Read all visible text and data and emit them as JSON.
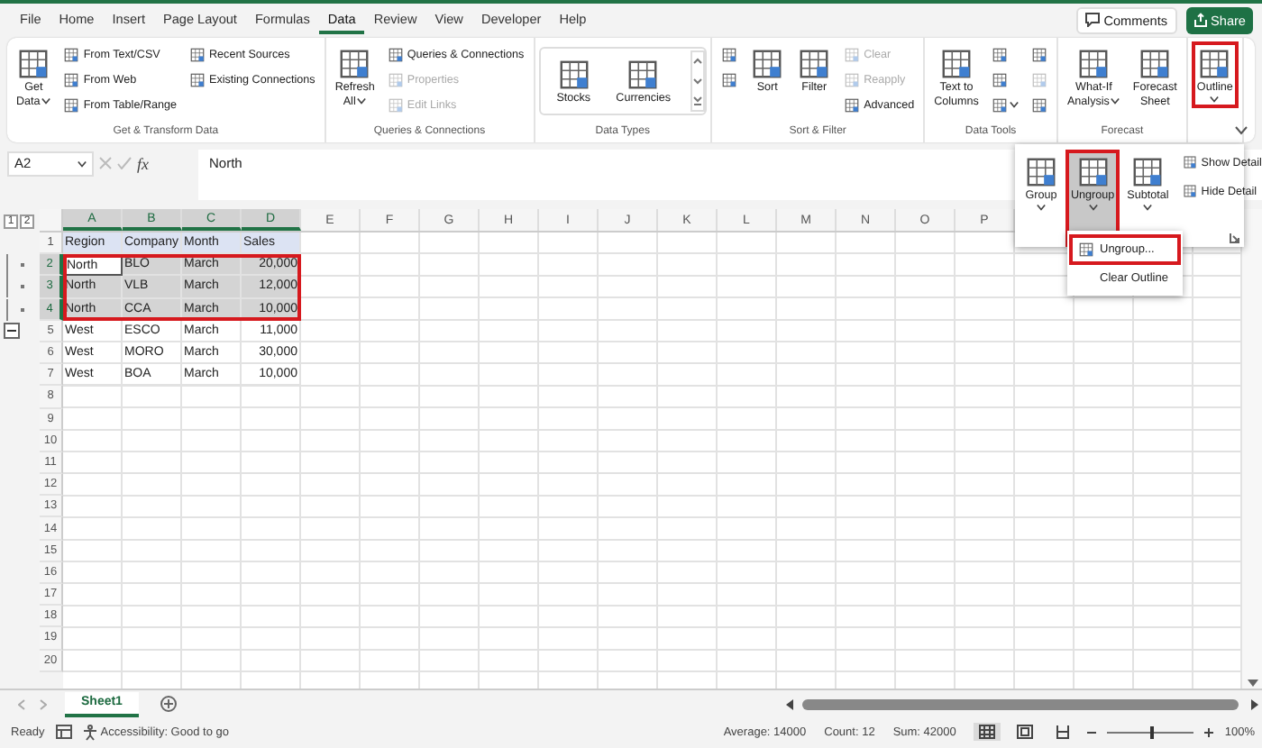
{
  "menu_tabs": [
    {
      "label": "File",
      "selected": false
    },
    {
      "label": "Home",
      "selected": false
    },
    {
      "label": "Insert",
      "selected": false
    },
    {
      "label": "Page Layout",
      "selected": false
    },
    {
      "label": "Formulas",
      "selected": false
    },
    {
      "label": "Data",
      "selected": true
    },
    {
      "label": "Review",
      "selected": false
    },
    {
      "label": "View",
      "selected": false
    },
    {
      "label": "Developer",
      "selected": false
    },
    {
      "label": "Help",
      "selected": false
    }
  ],
  "comments_button": "Comments",
  "share_button": "Share",
  "ribbon_groups": [
    {
      "kind": "plain",
      "label": "Get & Transform Data",
      "columns": [
        [
          {
            "kind": "large",
            "lines": [
              "Get",
              "Data"
            ],
            "caret": true,
            "disabled": false,
            "annotated": false
          }
        ],
        [
          {
            "kind": "small",
            "lines": [
              "From Text/CSV"
            ],
            "caret": false,
            "disabled": false,
            "annotated": false
          },
          {
            "kind": "small",
            "lines": [
              "From Web"
            ],
            "caret": false,
            "disabled": false,
            "annotated": false
          },
          {
            "kind": "small",
            "lines": [
              "From Table/Range"
            ],
            "caret": false,
            "disabled": false,
            "annotated": false
          }
        ],
        [
          {
            "kind": "small",
            "lines": [
              "Recent Sources"
            ],
            "caret": false,
            "disabled": false,
            "annotated": false
          },
          {
            "kind": "small",
            "lines": [
              "Existing Connections"
            ],
            "caret": false,
            "disabled": false,
            "annotated": false
          }
        ]
      ]
    },
    {
      "kind": "plain",
      "label": "Queries & Connections",
      "columns": [
        [
          {
            "kind": "large",
            "lines": [
              "Refresh",
              "All"
            ],
            "caret": true,
            "disabled": false,
            "annotated": false
          }
        ],
        [
          {
            "kind": "small",
            "lines": [
              "Queries & Connections"
            ],
            "caret": false,
            "disabled": false,
            "annotated": false
          },
          {
            "kind": "small",
            "lines": [
              "Properties"
            ],
            "caret": false,
            "disabled": true,
            "annotated": false
          },
          {
            "kind": "small",
            "lines": [
              "Edit Links"
            ],
            "caret": false,
            "disabled": true,
            "annotated": false
          }
        ]
      ]
    },
    {
      "kind": "gallery",
      "label": "Data Types",
      "columns": [
        [
          {
            "kind": "large",
            "lines": [
              "Stocks"
            ],
            "caret": false,
            "disabled": false,
            "annotated": false
          }
        ],
        [
          {
            "kind": "large",
            "lines": [
              "Currencies"
            ],
            "caret": false,
            "disabled": false,
            "annotated": false
          }
        ]
      ]
    },
    {
      "kind": "plain",
      "label": "Sort & Filter",
      "columns": [
        [
          {
            "kind": "icon",
            "caret": false,
            "disabled": false,
            "annotated": false
          },
          {
            "kind": "icon",
            "caret": false,
            "disabled": false,
            "annotated": false
          }
        ],
        [
          {
            "kind": "large",
            "lines": [
              "Sort"
            ],
            "caret": false,
            "disabled": false,
            "annotated": false
          }
        ],
        [
          {
            "kind": "large",
            "lines": [
              "Filter"
            ],
            "caret": false,
            "disabled": false,
            "annotated": false
          }
        ],
        [
          {
            "kind": "small",
            "lines": [
              "Clear"
            ],
            "caret": false,
            "disabled": true,
            "annotated": false
          },
          {
            "kind": "small",
            "lines": [
              "Reapply"
            ],
            "caret": false,
            "disabled": true,
            "annotated": false
          },
          {
            "kind": "small",
            "lines": [
              "Advanced"
            ],
            "caret": false,
            "disabled": false,
            "annotated": false
          }
        ]
      ]
    },
    {
      "kind": "plain",
      "label": "Data Tools",
      "columns": [
        [
          {
            "kind": "large",
            "lines": [
              "Text to",
              "Columns"
            ],
            "caret": false,
            "disabled": false,
            "annotated": false
          }
        ],
        [
          {
            "kind": "icon",
            "caret": false,
            "disabled": false,
            "annotated": false
          },
          {
            "kind": "icon",
            "caret": false,
            "disabled": false,
            "annotated": false
          },
          {
            "kind": "icon",
            "caret": true,
            "disabled": false,
            "annotated": false
          }
        ],
        [
          {
            "kind": "icon",
            "caret": false,
            "disabled": false,
            "annotated": false
          },
          {
            "kind": "icon",
            "caret": false,
            "disabled": true,
            "annotated": false
          },
          {
            "kind": "icon",
            "caret": false,
            "disabled": false,
            "annotated": false
          }
        ]
      ]
    },
    {
      "kind": "plain",
      "label": "Forecast",
      "columns": [
        [
          {
            "kind": "large",
            "lines": [
              "What-If",
              "Analysis"
            ],
            "caret": true,
            "disabled": false,
            "annotated": false
          }
        ],
        [
          {
            "kind": "large",
            "lines": [
              "Forecast",
              "Sheet"
            ],
            "caret": false,
            "disabled": false,
            "annotated": false
          }
        ]
      ]
    },
    {
      "kind": "plain",
      "columns": [
        [
          {
            "kind": "large",
            "lines": [
              "Outline"
            ],
            "caret": true,
            "disabled": false,
            "annotated": true
          }
        ]
      ]
    }
  ],
  "formula_bar": {
    "name_box": "A2",
    "function_label": "fx",
    "formula": "North"
  },
  "outline_levels": [
    "1",
    "2"
  ],
  "columns": [
    {
      "label": "A",
      "selected": true
    },
    {
      "label": "B",
      "selected": true
    },
    {
      "label": "C",
      "selected": true
    },
    {
      "label": "D",
      "selected": true
    },
    {
      "label": "E",
      "selected": false
    },
    {
      "label": "F",
      "selected": false
    },
    {
      "label": "G",
      "selected": false
    },
    {
      "label": "H",
      "selected": false
    },
    {
      "label": "I",
      "selected": false
    },
    {
      "label": "J",
      "selected": false
    },
    {
      "label": "K",
      "selected": false
    },
    {
      "label": "L",
      "selected": false
    },
    {
      "label": "M",
      "selected": false
    },
    {
      "label": "N",
      "selected": false
    },
    {
      "label": "O",
      "selected": false
    },
    {
      "label": "P",
      "selected": false
    }
  ],
  "rows": [
    {
      "number": "1",
      "kind": "header",
      "selected": false,
      "grouped": false,
      "collapse_button": false,
      "annotated": false,
      "cells": [
        {
          "text": "Region",
          "kind": "text",
          "active": false
        },
        {
          "text": "Company",
          "kind": "text",
          "active": false
        },
        {
          "text": "Month",
          "kind": "text",
          "active": false
        },
        {
          "text": "Sales",
          "kind": "text",
          "active": false
        }
      ]
    },
    {
      "number": "2",
      "kind": "data",
      "selected": true,
      "grouped": true,
      "collapse_button": false,
      "annotated": true,
      "cells": [
        {
          "text": "North",
          "kind": "text",
          "active": true
        },
        {
          "text": "BLO",
          "kind": "text",
          "active": false
        },
        {
          "text": "March",
          "kind": "text",
          "active": false
        },
        {
          "text": "20,000",
          "kind": "number",
          "active": false
        }
      ]
    },
    {
      "number": "3",
      "kind": "data",
      "selected": true,
      "grouped": true,
      "collapse_button": false,
      "annotated": true,
      "cells": [
        {
          "text": "North",
          "kind": "text",
          "active": false
        },
        {
          "text": "VLB",
          "kind": "text",
          "active": false
        },
        {
          "text": "March",
          "kind": "text",
          "active": false
        },
        {
          "text": "12,000",
          "kind": "number",
          "active": false
        }
      ]
    },
    {
      "number": "4",
      "kind": "data",
      "selected": true,
      "grouped": true,
      "collapse_button": false,
      "annotated": true,
      "cells": [
        {
          "text": "North",
          "kind": "text",
          "active": false
        },
        {
          "text": "CCA",
          "kind": "text",
          "active": false
        },
        {
          "text": "March",
          "kind": "text",
          "active": false
        },
        {
          "text": "10,000",
          "kind": "number",
          "active": false
        }
      ]
    },
    {
      "number": "5",
      "kind": "data",
      "selected": false,
      "grouped": false,
      "collapse_button": true,
      "annotated": false,
      "cells": [
        {
          "text": "West",
          "kind": "text",
          "active": false
        },
        {
          "text": "ESCO",
          "kind": "text",
          "active": false
        },
        {
          "text": "March",
          "kind": "text",
          "active": false
        },
        {
          "text": "11,000",
          "kind": "number",
          "active": false
        }
      ]
    },
    {
      "number": "6",
      "kind": "data",
      "selected": false,
      "grouped": false,
      "collapse_button": false,
      "annotated": false,
      "cells": [
        {
          "text": "West",
          "kind": "text",
          "active": false
        },
        {
          "text": "MORO",
          "kind": "text",
          "active": false
        },
        {
          "text": "March",
          "kind": "text",
          "active": false
        },
        {
          "text": "30,000",
          "kind": "number",
          "active": false
        }
      ]
    },
    {
      "number": "7",
      "kind": "data",
      "selected": false,
      "grouped": false,
      "collapse_button": false,
      "annotated": false,
      "cells": [
        {
          "text": "West",
          "kind": "text",
          "active": false
        },
        {
          "text": "BOA",
          "kind": "text",
          "active": false
        },
        {
          "text": "March",
          "kind": "text",
          "active": false
        },
        {
          "text": "10,000",
          "kind": "number",
          "active": false
        }
      ]
    },
    {
      "number": "8",
      "kind": "empty",
      "selected": false,
      "grouped": false,
      "collapse_button": false,
      "annotated": false
    },
    {
      "number": "9",
      "kind": "empty",
      "selected": false,
      "grouped": false,
      "collapse_button": false,
      "annotated": false
    },
    {
      "number": "10",
      "kind": "empty",
      "selected": false,
      "grouped": false,
      "collapse_button": false,
      "annotated": false
    },
    {
      "number": "11",
      "kind": "empty",
      "selected": false,
      "grouped": false,
      "collapse_button": false,
      "annotated": false
    },
    {
      "number": "12",
      "kind": "empty",
      "selected": false,
      "grouped": false,
      "collapse_button": false,
      "annotated": false
    },
    {
      "number": "13",
      "kind": "empty",
      "selected": false,
      "grouped": false,
      "collapse_button": false,
      "annotated": false
    },
    {
      "number": "14",
      "kind": "empty",
      "selected": false,
      "grouped": false,
      "collapse_button": false,
      "annotated": false
    },
    {
      "number": "15",
      "kind": "empty",
      "selected": false,
      "grouped": false,
      "collapse_button": false,
      "annotated": false
    },
    {
      "number": "16",
      "kind": "empty",
      "selected": false,
      "grouped": false,
      "collapse_button": false,
      "annotated": false
    },
    {
      "number": "17",
      "kind": "empty",
      "selected": false,
      "grouped": false,
      "collapse_button": false,
      "annotated": false
    },
    {
      "number": "18",
      "kind": "empty",
      "selected": false,
      "grouped": false,
      "collapse_button": false,
      "annotated": false
    },
    {
      "number": "19",
      "kind": "empty",
      "selected": false,
      "grouped": false,
      "collapse_button": false,
      "annotated": false
    },
    {
      "number": "20",
      "kind": "empty",
      "selected": false,
      "grouped": false,
      "collapse_button": false,
      "annotated": false
    }
  ],
  "outline_panel": {
    "items": [
      {
        "kind": "large",
        "lines": [
          "Group"
        ],
        "selected": false,
        "annotated": false
      },
      {
        "kind": "large",
        "lines": [
          "Ungroup"
        ],
        "selected": true,
        "annotated": true
      },
      {
        "kind": "large",
        "lines": [
          "Subtotal"
        ],
        "selected": false,
        "annotated": false
      },
      {
        "kind": "small",
        "lines": [
          "Show Detail"
        ],
        "selected": false,
        "annotated": false
      },
      {
        "kind": "small",
        "lines": [
          "Hide Detail"
        ],
        "selected": false,
        "annotated": false
      }
    ]
  },
  "ungroup_menu": [
    {
      "label": "Ungroup...",
      "annotated": true
    },
    {
      "label": "Clear Outline",
      "annotated": false
    }
  ],
  "sheet_tabs": [
    {
      "label": "Sheet1",
      "selected": true
    }
  ],
  "status_bar": {
    "ready": "Ready",
    "accessibility": "Accessibility: Good to go",
    "stats": [
      "Average: 14000",
      "Count: 12",
      "Sum: 42000"
    ],
    "views": [
      {
        "kind": "normal",
        "selected": true
      },
      {
        "kind": "page_layout",
        "selected": false
      },
      {
        "kind": "page_break",
        "selected": false
      }
    ],
    "zoom": {
      "level": 0.5,
      "reading": "100%"
    }
  }
}
